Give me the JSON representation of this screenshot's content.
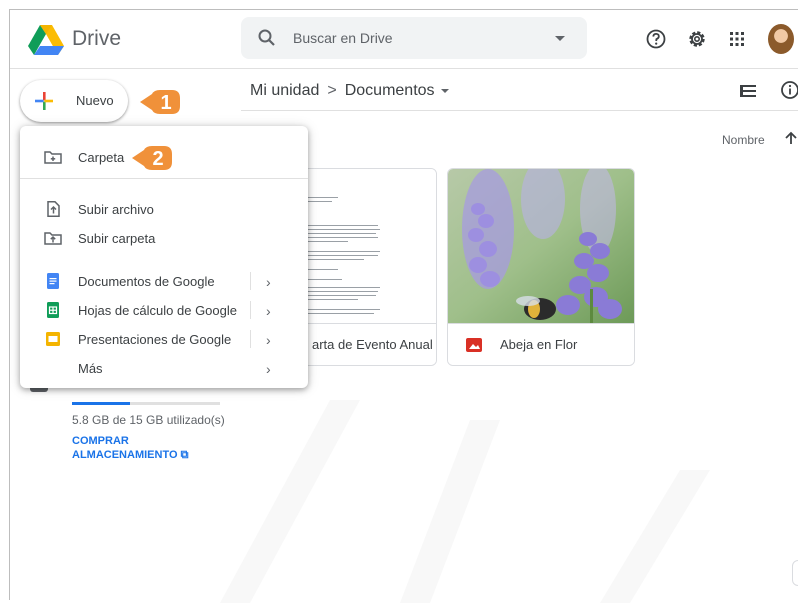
{
  "header": {
    "brand": "Drive",
    "search_placeholder": "Buscar en Drive"
  },
  "sidebar": {
    "new_label": "Nuevo",
    "storage_used_fraction": 0.39,
    "storage_text": "5.8 GB de 15 GB utilizado(s)",
    "buy_line1": "COMPRAR",
    "buy_line2": "ALMACENAMIENTO ⧉"
  },
  "callouts": {
    "first": "1",
    "second": "2"
  },
  "breadcrumb": {
    "root": "Mi unidad",
    "separator": ">",
    "current": "Documentos"
  },
  "sort": {
    "label": "Nombre"
  },
  "menu": {
    "items": [
      {
        "label": "Carpeta",
        "icon": "new-folder-icon"
      },
      {
        "label": "Subir archivo",
        "icon": "upload-file-icon"
      },
      {
        "label": "Subir carpeta",
        "icon": "upload-folder-icon"
      },
      {
        "label": "Documentos de Google",
        "icon": "google-docs-icon",
        "submenu": true
      },
      {
        "label": "Hojas de cálculo de Google",
        "icon": "google-sheets-icon",
        "submenu": true
      },
      {
        "label": "Presentaciones de Google",
        "icon": "google-slides-icon",
        "submenu": true
      },
      {
        "label": "Más",
        "submenu": true
      }
    ],
    "submenu_arrow": "›"
  },
  "files": [
    {
      "name": "Carta de Evento Anual",
      "visible_name": "arta de Evento Anual",
      "icon": "doc-icon"
    },
    {
      "name": "Abeja en Flor",
      "icon": "image-icon",
      "icon_color": "#d93025"
    }
  ],
  "colors": {
    "accent": "#1a73e8",
    "callout": "#f0913a",
    "docs": "#4285f4",
    "sheets": "#0f9d58",
    "slides": "#f4b400"
  }
}
